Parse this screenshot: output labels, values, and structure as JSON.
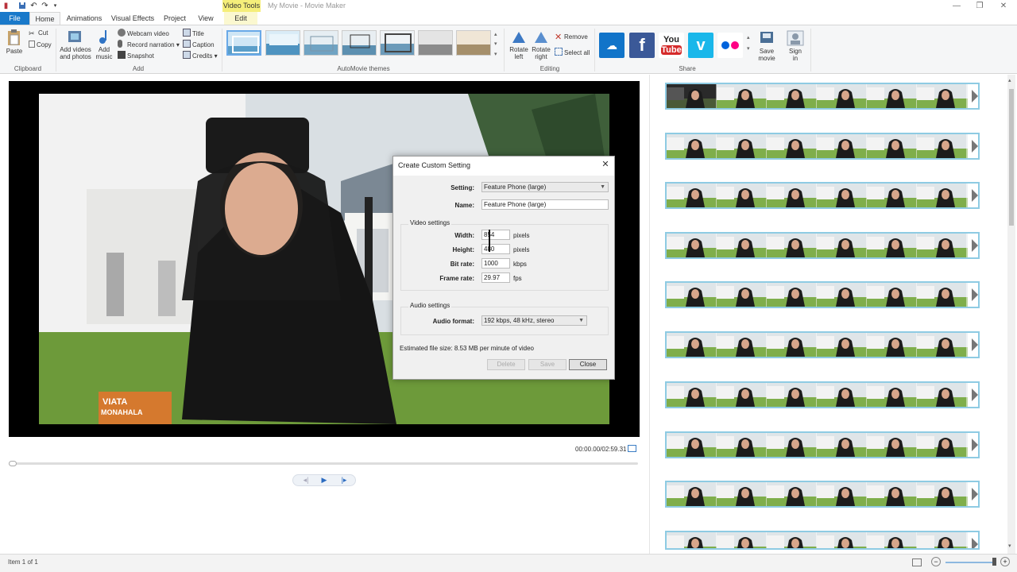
{
  "window": {
    "title": "My Movie - Movie Maker",
    "context_tab": "Video Tools",
    "controls": [
      "minimize",
      "restore",
      "close"
    ]
  },
  "tabs": [
    {
      "label": "File"
    },
    {
      "label": "Home"
    },
    {
      "label": "Animations"
    },
    {
      "label": "Visual Effects"
    },
    {
      "label": "Project"
    },
    {
      "label": "View"
    },
    {
      "label": "Edit"
    }
  ],
  "ribbon": {
    "clipboard": {
      "paste": "Paste",
      "cut": "Cut",
      "copy": "Copy",
      "group": "Clipboard"
    },
    "add": {
      "add_videos_line1": "Add videos",
      "add_videos_line2": "and photos",
      "add_music_line1": "Add",
      "add_music_line2": "music",
      "webcam": "Webcam video",
      "narration": "Record narration",
      "snapshot": "Snapshot",
      "title": "Title",
      "caption": "Caption",
      "credits": "Credits",
      "group": "Add"
    },
    "themes": {
      "group": "AutoMovie themes"
    },
    "editing": {
      "rotate_left_1": "Rotate",
      "rotate_left_2": "left",
      "rotate_right_1": "Rotate",
      "rotate_right_2": "right",
      "remove": "Remove",
      "select_all": "Select all",
      "group": "Editing"
    },
    "share": {
      "save_movie_1": "Save",
      "save_movie_2": "movie",
      "sign_in_1": "Sign",
      "sign_in_2": "in",
      "group": "Share",
      "youtube_1": "You",
      "youtube_2": "Tube"
    }
  },
  "preview": {
    "logo_line1": "VIATA",
    "logo_line2": "MONAHALA",
    "timecode": "00:00.00/02:59.31"
  },
  "dialog": {
    "title": "Create Custom Setting",
    "close": "✕",
    "setting_label": "Setting:",
    "setting_value": "Feature Phone (large)",
    "name_label": "Name:",
    "name_value": "Feature Phone (large)",
    "video_settings": "Video settings",
    "width_label": "Width:",
    "width_value": "854",
    "height_label": "Height:",
    "height_value": "480",
    "bitrate_label": "Bit rate:",
    "bitrate_value": "1000",
    "framerate_label": "Frame rate:",
    "framerate_value": "29.97",
    "pixels": "pixels",
    "kbps": "kbps",
    "fps": "fps",
    "audio_settings": "Audio settings",
    "audio_format_label": "Audio format:",
    "audio_format_value": "192 kbps, 48 kHz, stereo",
    "file_size": "Estimated file size: 8.53 MB per minute of video",
    "delete": "Delete",
    "save": "Save",
    "close_button": "Close"
  },
  "status": {
    "item": "Item 1 of 1"
  },
  "colors": {
    "file_tab": "#1979ca",
    "context_tab": "#f5ee7a",
    "strip_border": "#8ecbe3"
  }
}
